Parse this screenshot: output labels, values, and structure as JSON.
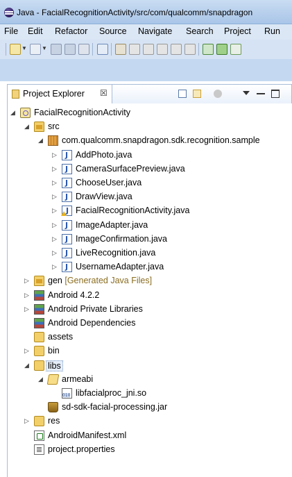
{
  "window": {
    "title": "Java - FacialRecognitionActivity/src/com/qualcomm/snapdragon"
  },
  "menu": [
    "File",
    "Edit",
    "Refactor",
    "Source",
    "Navigate",
    "Search",
    "Project",
    "Run"
  ],
  "view": {
    "title": "Project Explorer",
    "close_glyph": "☒"
  },
  "tree": [
    {
      "depth": 0,
      "expanded": true,
      "icon": "project-icon",
      "label": "FacialRecognitionActivity"
    },
    {
      "depth": 1,
      "expanded": true,
      "icon": "source-folder-icon",
      "label": "src"
    },
    {
      "depth": 2,
      "expanded": true,
      "icon": "package-icon",
      "label": "com.qualcomm.snapdragon.sdk.recognition.sample"
    },
    {
      "depth": 3,
      "expanded": false,
      "icon": "java-file-icon",
      "label": "AddPhoto.java"
    },
    {
      "depth": 3,
      "expanded": false,
      "icon": "java-file-icon",
      "label": "CameraSurfacePreview.java"
    },
    {
      "depth": 3,
      "expanded": false,
      "icon": "java-file-icon",
      "label": "ChooseUser.java"
    },
    {
      "depth": 3,
      "expanded": false,
      "icon": "java-file-icon",
      "label": "DrawView.java"
    },
    {
      "depth": 3,
      "expanded": false,
      "icon": "java-file-warning-icon",
      "label": "FacialRecognitionActivity.java"
    },
    {
      "depth": 3,
      "expanded": false,
      "icon": "java-file-icon",
      "label": "ImageAdapter.java"
    },
    {
      "depth": 3,
      "expanded": false,
      "icon": "java-file-icon",
      "label": "ImageConfirmation.java"
    },
    {
      "depth": 3,
      "expanded": false,
      "icon": "java-file-icon",
      "label": "LiveRecognition.java"
    },
    {
      "depth": 3,
      "expanded": false,
      "icon": "java-file-icon",
      "label": "UsernameAdapter.java"
    },
    {
      "depth": 1,
      "expanded": false,
      "icon": "source-folder-icon",
      "label": "gen",
      "decoration": "[Generated Java Files]"
    },
    {
      "depth": 1,
      "expanded": false,
      "icon": "library-icon",
      "label": "Android 4.2.2"
    },
    {
      "depth": 1,
      "expanded": false,
      "icon": "library-icon",
      "label": "Android Private Libraries"
    },
    {
      "depth": 1,
      "expanded": null,
      "icon": "library-icon",
      "label": "Android Dependencies"
    },
    {
      "depth": 1,
      "expanded": null,
      "icon": "folder-icon",
      "label": "assets"
    },
    {
      "depth": 1,
      "expanded": false,
      "icon": "folder-icon",
      "label": "bin"
    },
    {
      "depth": 1,
      "expanded": true,
      "icon": "folder-icon",
      "label": "libs",
      "selected": true
    },
    {
      "depth": 2,
      "expanded": true,
      "icon": "folder-open-icon",
      "label": "armeabi"
    },
    {
      "depth": 3,
      "expanded": null,
      "icon": "binary-file-icon",
      "label": "libfacialproc_jni.so"
    },
    {
      "depth": 2,
      "expanded": null,
      "icon": "jar-icon",
      "label": "sd-sdk-facial-processing.jar"
    },
    {
      "depth": 1,
      "expanded": false,
      "icon": "folder-icon",
      "label": "res"
    },
    {
      "depth": 1,
      "expanded": null,
      "icon": "manifest-file-icon",
      "label": "AndroidManifest.xml"
    },
    {
      "depth": 1,
      "expanded": null,
      "icon": "properties-file-icon",
      "label": "project.properties"
    }
  ],
  "glyphs": {
    "expanded": "◢",
    "collapsed": "▷"
  },
  "colors": {
    "selection": "#e6eef9",
    "decoration": "#8a6d20",
    "title_bar": "#b9d1ee"
  }
}
